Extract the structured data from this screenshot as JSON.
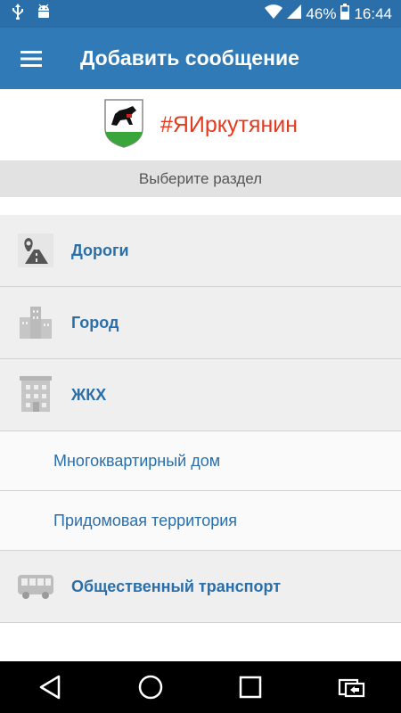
{
  "status_bar": {
    "battery_percent": "46%",
    "time": "16:44",
    "icons": [
      "usb-icon",
      "android-debug-icon",
      "wifi-icon",
      "signal-icon",
      "battery-icon"
    ]
  },
  "app_bar": {
    "title": "Добавить сообщение",
    "menu_icon": "hamburger-menu-icon"
  },
  "brand": {
    "hashtag": "#ЯИркутянин",
    "logo_icon": "irkutsk-coat-of-arms-icon"
  },
  "section_hint": "Выберите раздел",
  "categories": [
    {
      "label": "Дороги",
      "icon": "road-icon"
    },
    {
      "label": "Город",
      "icon": "city-buildings-icon"
    },
    {
      "label": "ЖКХ",
      "icon": "housing-building-icon"
    }
  ],
  "subcategories": [
    {
      "label": "Многоквартирный дом"
    },
    {
      "label": "Придомовая территория"
    }
  ],
  "transport": {
    "label": "Общественный транспорт",
    "icon": "bus-icon"
  },
  "nav_bar": {
    "icons": [
      "back-icon",
      "home-icon",
      "recents-icon",
      "rotate-icon"
    ]
  },
  "colors": {
    "accent": "#2f7ab7",
    "statusbar": "#2a6faa",
    "hashtag": "#e63a1e"
  }
}
